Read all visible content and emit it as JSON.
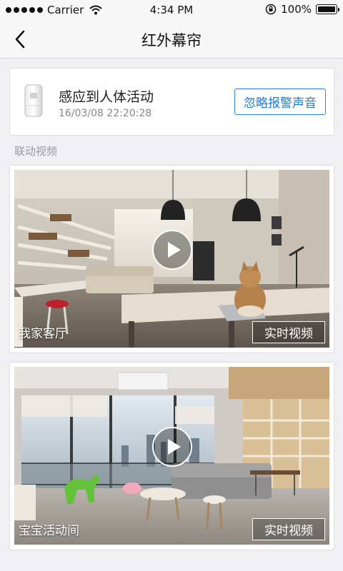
{
  "status_bar": {
    "carrier": "Carrier",
    "time": "4:34 PM",
    "battery": "100%"
  },
  "nav": {
    "title": "红外幕帘",
    "back_icon": "chevron-left-icon"
  },
  "alert": {
    "title": "感应到人体活动",
    "time": "16/03/08 22:20:28",
    "ignore_label": "忽略报警声音",
    "accent_color": "#1f7ad9"
  },
  "section": {
    "label": "联动视频"
  },
  "videos": [
    {
      "room": "我家客厅",
      "live_label": "实时视频"
    },
    {
      "room": "宝宝活动间",
      "live_label": "实时视频"
    }
  ]
}
